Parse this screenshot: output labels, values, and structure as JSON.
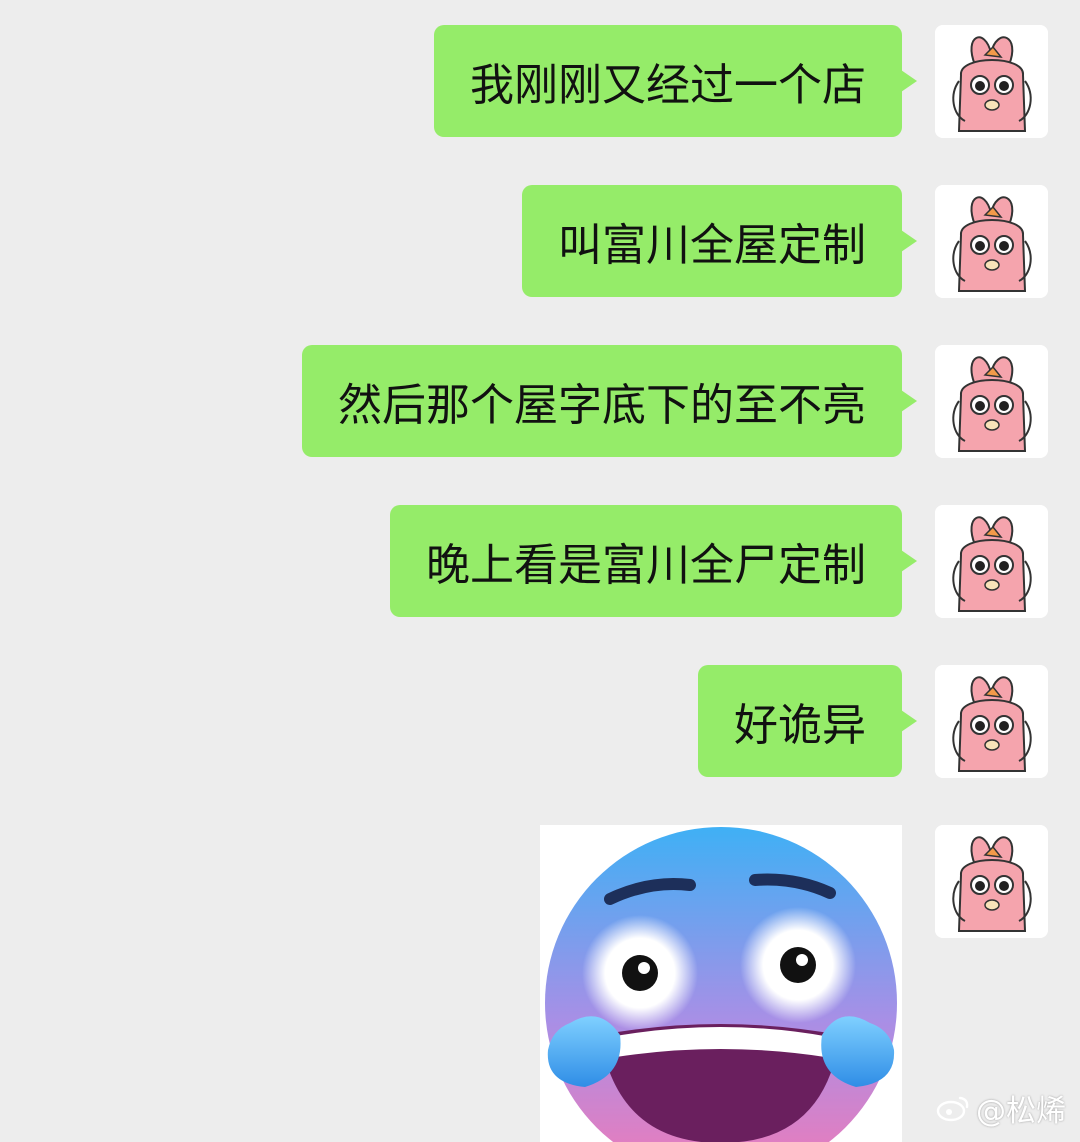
{
  "messages": [
    {
      "text": "我刚刚又经过一个店"
    },
    {
      "text": "叫富川全屋定制"
    },
    {
      "text": "然后那个屋字底下的至不亮"
    },
    {
      "text": "晚上看是富川全尸定制"
    },
    {
      "text": "好诡异"
    }
  ],
  "sticker": {
    "icon": "crying-laughing-face-icon"
  },
  "avatar": {
    "icon": "pink-cartoon-character-icon"
  },
  "watermark": {
    "handle": "@松烯",
    "icon": "weibo-logo-icon"
  },
  "colors": {
    "background": "#ededed",
    "bubble": "#95ec69",
    "text": "#111111"
  }
}
